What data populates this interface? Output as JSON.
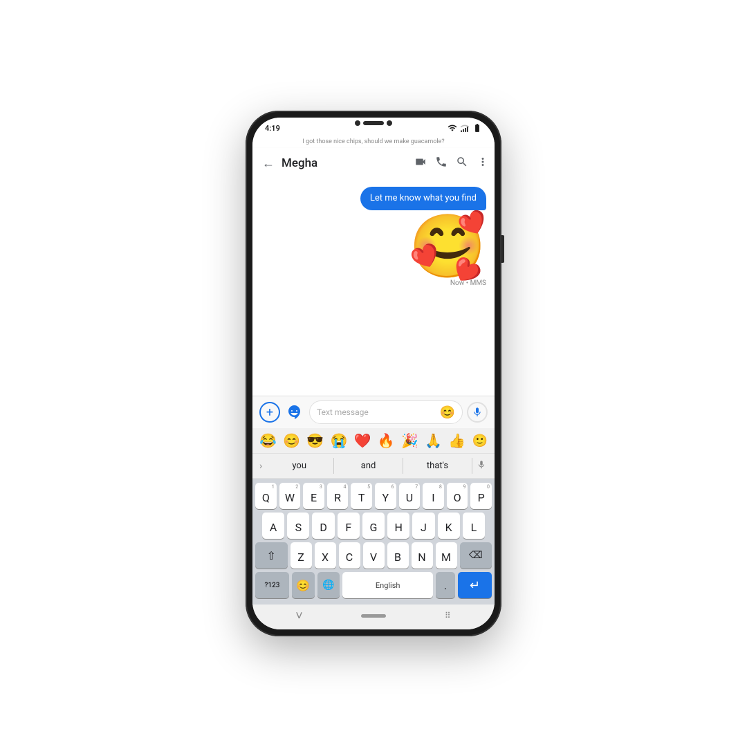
{
  "phone": {
    "status_bar": {
      "time": "4:19",
      "battery_icon": "battery",
      "signal_icon": "signal",
      "wifi_icon": "wifi"
    },
    "app_bar": {
      "back_label": "←",
      "contact_name": "Megha",
      "icons": [
        "video-call",
        "phone",
        "search",
        "more"
      ]
    },
    "messages": [
      {
        "id": "msg1",
        "prev_hint": "I got those nice chips, should we make guacamole?",
        "type": "bubble",
        "text": "Let me know what you find",
        "align": "right"
      },
      {
        "id": "msg2",
        "type": "emoji",
        "emoji": "🥰",
        "meta": "Now • MMS",
        "align": "right"
      }
    ],
    "input": {
      "placeholder": "Text message",
      "plus_label": "+",
      "emoji_label": "😊",
      "mic_label": "🎤"
    },
    "emoji_bar": {
      "emojis": [
        "😂",
        "😊",
        "😎",
        "😭",
        "❤️",
        "🔥",
        "🎉",
        "🙏",
        "👍"
      ],
      "smiley": "🙂"
    },
    "suggestions": {
      "expand_icon": ">",
      "items": [
        "you",
        "and",
        "that's"
      ],
      "mic_icon": "🎤"
    },
    "keyboard": {
      "rows": [
        {
          "keys": [
            {
              "letter": "Q",
              "num": "1"
            },
            {
              "letter": "W",
              "num": "2"
            },
            {
              "letter": "E",
              "num": "3"
            },
            {
              "letter": "R",
              "num": "4"
            },
            {
              "letter": "T",
              "num": "5"
            },
            {
              "letter": "Y",
              "num": "6"
            },
            {
              "letter": "U",
              "num": "7"
            },
            {
              "letter": "I",
              "num": "8"
            },
            {
              "letter": "O",
              "num": "9"
            },
            {
              "letter": "P",
              "num": "0"
            }
          ]
        },
        {
          "keys": [
            {
              "letter": "A"
            },
            {
              "letter": "S"
            },
            {
              "letter": "D"
            },
            {
              "letter": "F"
            },
            {
              "letter": "G"
            },
            {
              "letter": "H"
            },
            {
              "letter": "J"
            },
            {
              "letter": "K"
            },
            {
              "letter": "L"
            }
          ]
        },
        {
          "keys": [
            {
              "letter": "⇧",
              "special": true,
              "type": "shift"
            },
            {
              "letter": "Z"
            },
            {
              "letter": "X"
            },
            {
              "letter": "C"
            },
            {
              "letter": "V"
            },
            {
              "letter": "B"
            },
            {
              "letter": "N"
            },
            {
              "letter": "M"
            },
            {
              "letter": "⌫",
              "special": true,
              "type": "backspace"
            }
          ]
        },
        {
          "keys": [
            {
              "letter": "?123",
              "special": true,
              "type": "symbols"
            },
            {
              "letter": "😊",
              "special": true,
              "type": "emoji-key"
            },
            {
              "letter": "🌐",
              "special": true,
              "type": "lang"
            },
            {
              "letter": "English",
              "type": "space"
            },
            {
              "letter": ".",
              "special": true,
              "type": "period"
            },
            {
              "letter": "↵",
              "special": true,
              "type": "enter"
            }
          ]
        }
      ]
    },
    "bottom_nav": {
      "chevron": "˅",
      "pill": "",
      "grid": "⠿"
    }
  }
}
